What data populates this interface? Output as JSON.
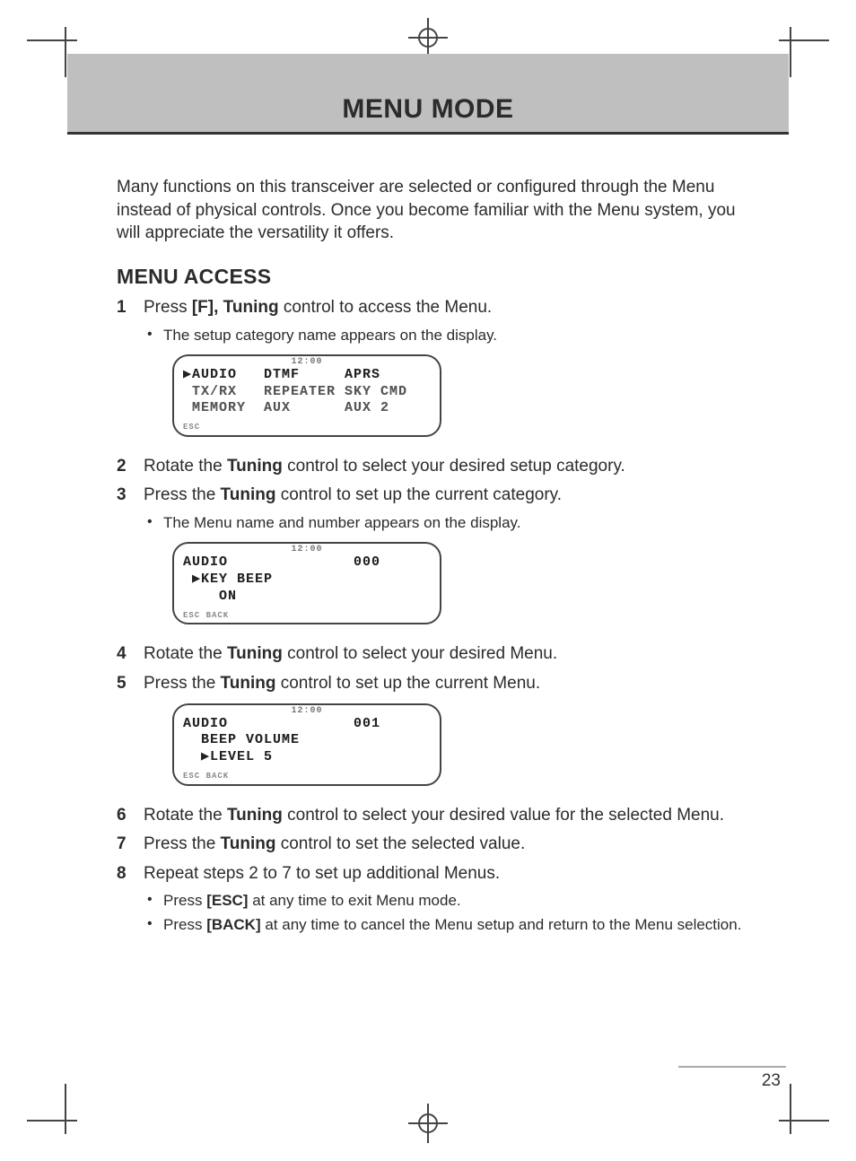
{
  "header": {
    "title": "MENU MODE"
  },
  "intro": "Many functions on this transceiver are selected or configured through the Menu instead of physical controls.  Once you become familiar with the Menu system, you will appreciate the versatility it offers.",
  "section": {
    "heading": "MENU ACCESS"
  },
  "steps": {
    "s1": {
      "num": "1",
      "text_a": "Press ",
      "bold_a": "[F], Tuning",
      "text_b": " control to access the Menu.",
      "sub1": "The setup category name appears on the display."
    },
    "s2": {
      "num": "2",
      "text_a": "Rotate the ",
      "bold_a": "Tuning",
      "text_b": " control to select your desired setup category."
    },
    "s3": {
      "num": "3",
      "text_a": "Press the ",
      "bold_a": "Tuning",
      "text_b": " control to set up the current category.",
      "sub1": "The Menu name and number appears on the display."
    },
    "s4": {
      "num": "4",
      "text_a": "Rotate the ",
      "bold_a": "Tuning",
      "text_b": " control to select your desired Menu."
    },
    "s5": {
      "num": "5",
      "text_a": "Press the ",
      "bold_a": "Tuning",
      "text_b": " control to set up the current Menu."
    },
    "s6": {
      "num": "6",
      "text_a": "Rotate the ",
      "bold_a": "Tuning",
      "text_b": " control to select your desired value for the selected Menu."
    },
    "s7": {
      "num": "7",
      "text_a": "Press the ",
      "bold_a": "Tuning",
      "text_b": " control to set the selected value."
    },
    "s8": {
      "num": "8",
      "text_a": "Repeat steps 2 to 7 to set up additional Menus.",
      "sub1_a": "Press ",
      "sub1_bold": "[ESC]",
      "sub1_b": " at any time to exit Menu mode.",
      "sub2_a": "Press ",
      "sub2_bold": "[BACK]",
      "sub2_b": " at any time to cancel the Menu setup and return to the Menu selection."
    }
  },
  "lcd1": {
    "time": "12:00",
    "row1": "▶AUDIO   DTMF     APRS",
    "row2": " TX/RX   REPEATER SKY CMD",
    "row3": " MEMORY  AUX      AUX 2",
    "footer": "ESC"
  },
  "lcd2": {
    "time": "12:00",
    "row1": "AUDIO              000",
    "row2": " ▶KEY BEEP",
    "row3": "    ON",
    "footer": "ESC BACK"
  },
  "lcd3": {
    "time": "12:00",
    "row1": "AUDIO              001",
    "row2": "  BEEP VOLUME",
    "row3": "  ▶LEVEL 5",
    "footer": "ESC BACK"
  },
  "page_number": "23"
}
